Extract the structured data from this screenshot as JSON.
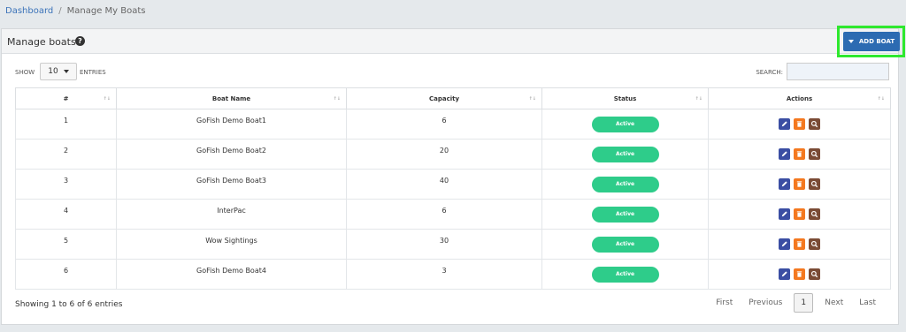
{
  "breadcrumb": {
    "home": "Dashboard",
    "separator": "/",
    "current": "Manage My Boats"
  },
  "panel": {
    "title": "Manage boats",
    "help_icon": "question-circle-icon"
  },
  "add_button": {
    "label": "ADD BOAT"
  },
  "controls": {
    "show_label": "SHOW",
    "entries_value": "10",
    "entries_label": "ENTRIES",
    "search_label": "SEARCH:",
    "search_value": ""
  },
  "table": {
    "columns": [
      "#",
      "Boat Name",
      "Capacity",
      "Status",
      "Actions"
    ],
    "rows": [
      {
        "num": "1",
        "name": "GoFish Demo Boat1",
        "capacity": "6",
        "status": "Active"
      },
      {
        "num": "2",
        "name": "GoFish Demo Boat2",
        "capacity": "20",
        "status": "Active"
      },
      {
        "num": "3",
        "name": "GoFish Demo Boat3",
        "capacity": "40",
        "status": "Active"
      },
      {
        "num": "4",
        "name": "InterPac",
        "capacity": "6",
        "status": "Active"
      },
      {
        "num": "5",
        "name": "Wow Sightings",
        "capacity": "30",
        "status": "Active"
      },
      {
        "num": "6",
        "name": "GoFish Demo Boat4",
        "capacity": "3",
        "status": "Active"
      }
    ]
  },
  "footer": {
    "info": "Showing 1 to 6 of 6 entries"
  },
  "pagination": {
    "first": "First",
    "previous": "Previous",
    "current": "1",
    "next": "Next",
    "last": "Last"
  },
  "colors": {
    "accent": "#2c6bb2",
    "active": "#2ecc8a",
    "edit": "#3b4ea3",
    "delete": "#f4781f",
    "view": "#7a4b35",
    "highlight": "#2ee82e"
  }
}
